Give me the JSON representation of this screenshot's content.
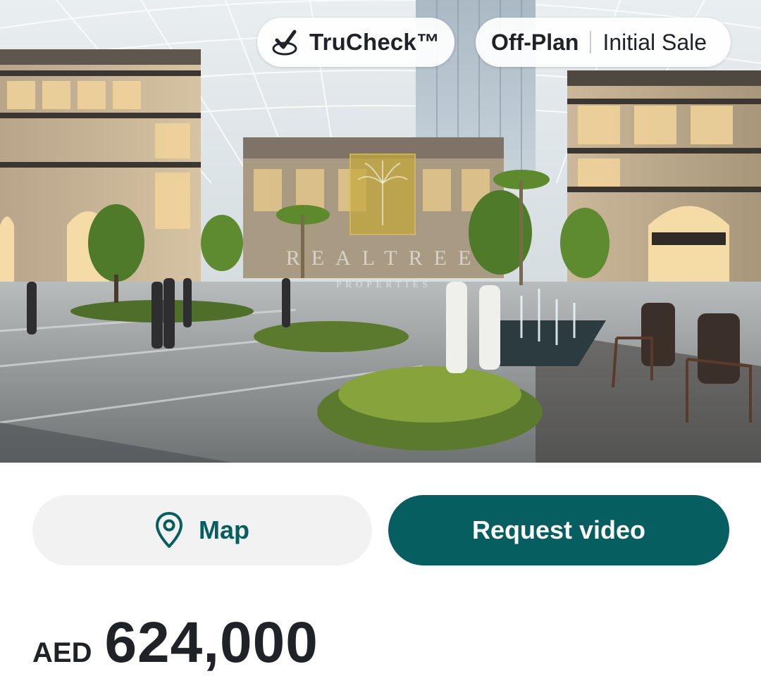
{
  "hero": {
    "image_alt": "Rendering of an indoor glass-roofed plaza with shops, palm trees, fountains and people",
    "watermark": {
      "brand": "REALTREE",
      "subtitle": "PROPERTIES"
    },
    "badges": {
      "trucheck": {
        "icon": "checkmark-badge-icon",
        "label": "TruCheck™"
      },
      "status": {
        "primary": "Off-Plan",
        "secondary": "Initial Sale"
      }
    }
  },
  "actions": {
    "map": {
      "icon": "map-pin-icon",
      "label": "Map"
    },
    "request_video": {
      "label": "Request video"
    }
  },
  "price": {
    "currency": "AED",
    "amount": "624,000"
  },
  "colors": {
    "brand_teal": "#075e61",
    "map_button_bg": "#f2f2f3",
    "text_dark": "#1f2327"
  }
}
